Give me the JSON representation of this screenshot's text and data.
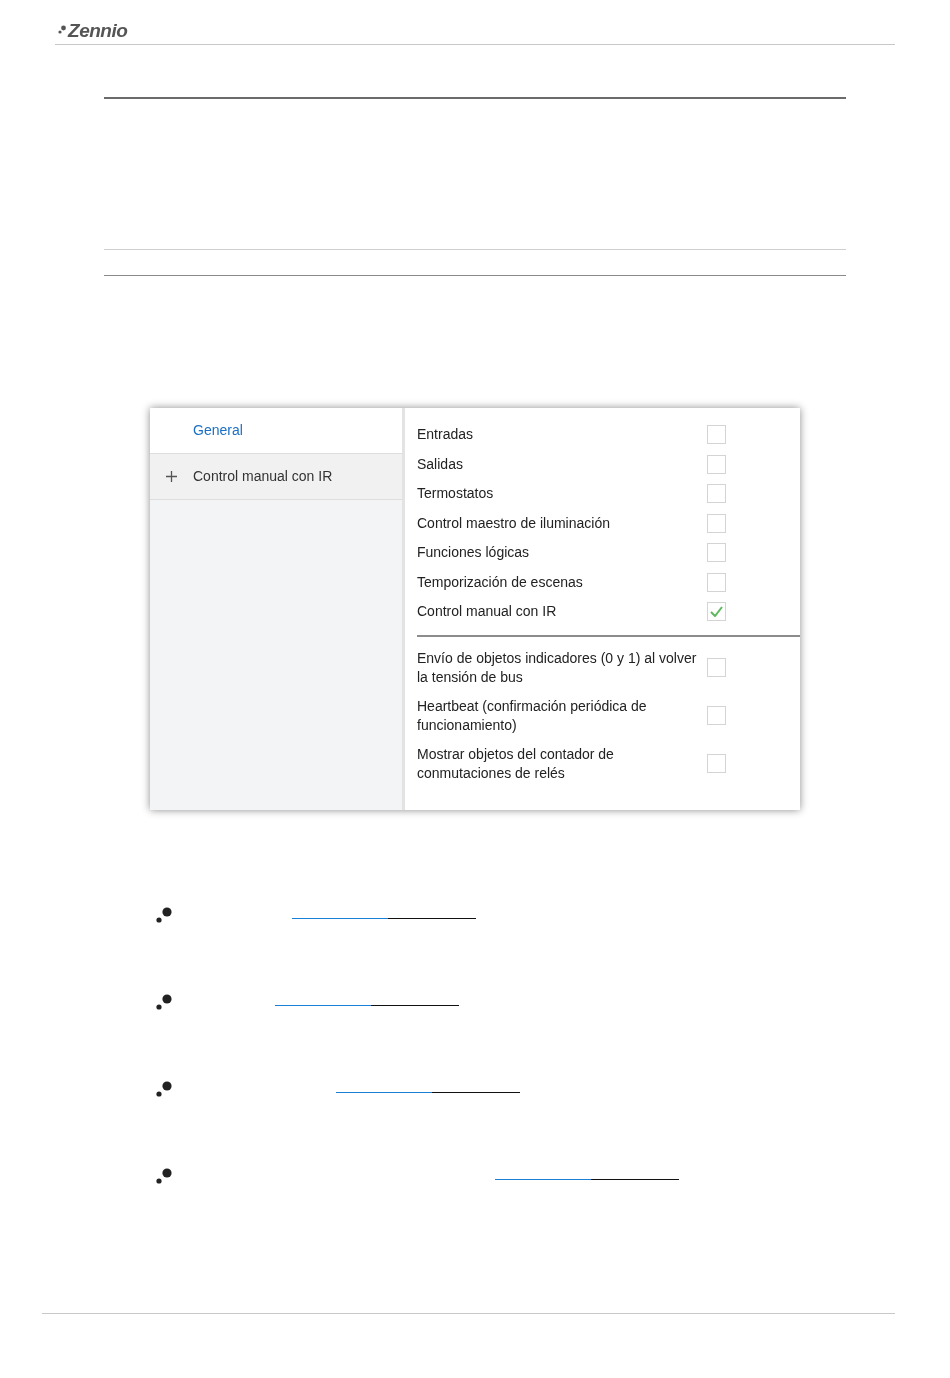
{
  "header": {
    "logo": "Zennio"
  },
  "dialog": {
    "sidebar": [
      {
        "label": "General",
        "selected": true,
        "expandable": false
      },
      {
        "label": "Control manual con IR",
        "selected": false,
        "expandable": true
      }
    ],
    "modules": [
      {
        "label": "Entradas",
        "checked": false
      },
      {
        "label": "Salidas",
        "checked": false
      },
      {
        "label": "Termostatos",
        "checked": false
      },
      {
        "label": "Control maestro de iluminación",
        "checked": false
      },
      {
        "label": "Funciones lógicas",
        "checked": false
      },
      {
        "label": "Temporización de escenas",
        "checked": false
      },
      {
        "label": "Control manual con IR",
        "checked": true
      }
    ],
    "options": [
      {
        "label": "Envío de objetos indicadores (0 y 1) al volver la tensión de bus",
        "checked": false
      },
      {
        "label": "Heartbeat (confirmación periódica de funcionamiento)",
        "checked": false
      },
      {
        "label": "Mostrar objetos del contador de conmutaciones de relés",
        "checked": false
      }
    ]
  }
}
